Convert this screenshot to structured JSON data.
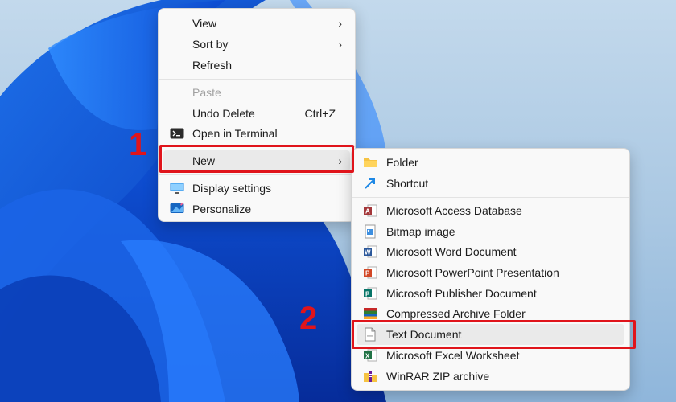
{
  "main_menu": {
    "items": [
      {
        "label": "View",
        "submenu": true
      },
      {
        "label": "Sort by",
        "submenu": true
      },
      {
        "label": "Refresh"
      },
      {
        "label": "Paste",
        "disabled": true
      },
      {
        "label": "Undo Delete",
        "shortcut": "Ctrl+Z"
      },
      {
        "label": "Open in Terminal",
        "icon": "terminal-icon"
      },
      {
        "label": "New",
        "submenu": true,
        "highlighted": true
      },
      {
        "label": "Display settings",
        "icon": "display-icon"
      },
      {
        "label": "Personalize",
        "icon": "personalize-icon"
      }
    ],
    "chevron": "›"
  },
  "new_submenu": {
    "items": [
      {
        "label": "Folder",
        "icon": "folder-icon"
      },
      {
        "label": "Shortcut",
        "icon": "shortcut-icon"
      },
      {
        "label": "Microsoft Access Database",
        "icon": "access-icon"
      },
      {
        "label": "Bitmap image",
        "icon": "bitmap-icon"
      },
      {
        "label": "Microsoft Word Document",
        "icon": "word-icon"
      },
      {
        "label": "Microsoft PowerPoint Presentation",
        "icon": "powerpoint-icon"
      },
      {
        "label": "Microsoft Publisher Document",
        "icon": "publisher-icon"
      },
      {
        "label": "Compressed Archive Folder",
        "icon": "archive-icon"
      },
      {
        "label": "Text Document",
        "icon": "text-document-icon",
        "highlighted": true
      },
      {
        "label": "Microsoft Excel Worksheet",
        "icon": "excel-icon"
      },
      {
        "label": "WinRAR ZIP archive",
        "icon": "winrar-icon"
      }
    ]
  },
  "annotations": {
    "step1": "1",
    "step2": "2",
    "highlight_color": "#e0141b"
  }
}
